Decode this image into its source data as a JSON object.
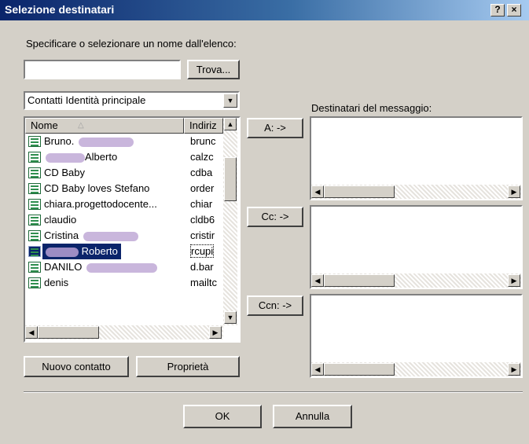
{
  "window": {
    "title": "Selezione destinatari",
    "help_label": "?",
    "close_label": "×"
  },
  "search": {
    "instruction": "Specificare o selezionare un nome dall'elenco:",
    "value": "",
    "find_button": "Trova..."
  },
  "address_book": {
    "selected": "Contatti Identità principale"
  },
  "contacts": {
    "columns": {
      "name": "Nome",
      "email": "Indiriz"
    },
    "rows": [
      {
        "name": "Bruno. ",
        "email": "brunc"
      },
      {
        "name": "Alberto",
        "email": "calzc"
      },
      {
        "name": "CD Baby",
        "email": "cdba"
      },
      {
        "name": "CD Baby loves Stefano",
        "email": "order"
      },
      {
        "name": "chiara.progettodocente...",
        "email": "chiar"
      },
      {
        "name": "claudio",
        "email": "cldb6"
      },
      {
        "name": "Cristina ",
        "email": "cristir"
      },
      {
        "name": "Roberto",
        "email": "rcupi"
      },
      {
        "name": "DANILO ",
        "email": "d.bar"
      },
      {
        "name": "denis",
        "email": "mailtc"
      }
    ]
  },
  "recipients": {
    "heading": "Destinatari del messaggio:",
    "to_button": "A: ->",
    "cc_button": "Cc: ->",
    "bcc_button": "Ccn: ->"
  },
  "actions": {
    "new_contact": "Nuovo contatto",
    "properties": "Proprietà",
    "ok": "OK",
    "cancel": "Annulla"
  },
  "icons": {
    "contact": "contact-card-icon",
    "sort": "sort-ascending-icon",
    "scroll_up": "scroll-up-arrow-icon",
    "scroll_down": "scroll-down-arrow-icon",
    "scroll_left": "scroll-left-arrow-icon",
    "scroll_right": "scroll-right-arrow-icon",
    "dropdown": "chevron-down-icon"
  },
  "colors": {
    "title_bar": "#0a246a",
    "selection": "#0a246a",
    "window_face": "#d4d0c8",
    "contact_icon": "#2f8f4f"
  }
}
